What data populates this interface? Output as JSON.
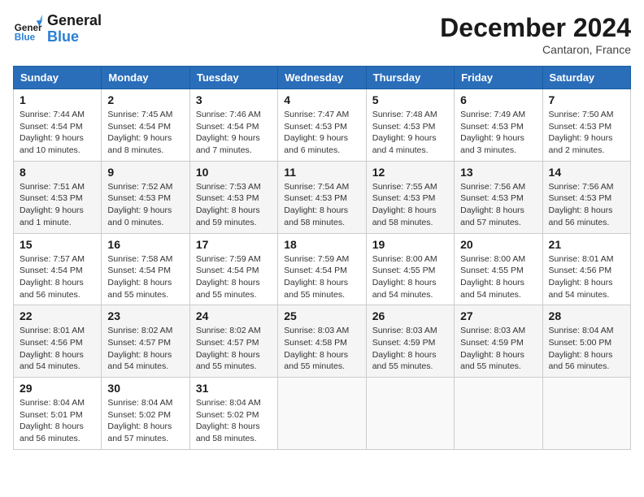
{
  "header": {
    "logo_line1": "General",
    "logo_line2": "Blue",
    "month": "December 2024",
    "location": "Cantaron, France"
  },
  "weekdays": [
    "Sunday",
    "Monday",
    "Tuesday",
    "Wednesday",
    "Thursday",
    "Friday",
    "Saturday"
  ],
  "weeks": [
    [
      {
        "day": "1",
        "info": "Sunrise: 7:44 AM\nSunset: 4:54 PM\nDaylight: 9 hours\nand 10 minutes."
      },
      {
        "day": "2",
        "info": "Sunrise: 7:45 AM\nSunset: 4:54 PM\nDaylight: 9 hours\nand 8 minutes."
      },
      {
        "day": "3",
        "info": "Sunrise: 7:46 AM\nSunset: 4:54 PM\nDaylight: 9 hours\nand 7 minutes."
      },
      {
        "day": "4",
        "info": "Sunrise: 7:47 AM\nSunset: 4:53 PM\nDaylight: 9 hours\nand 6 minutes."
      },
      {
        "day": "5",
        "info": "Sunrise: 7:48 AM\nSunset: 4:53 PM\nDaylight: 9 hours\nand 4 minutes."
      },
      {
        "day": "6",
        "info": "Sunrise: 7:49 AM\nSunset: 4:53 PM\nDaylight: 9 hours\nand 3 minutes."
      },
      {
        "day": "7",
        "info": "Sunrise: 7:50 AM\nSunset: 4:53 PM\nDaylight: 9 hours\nand 2 minutes."
      }
    ],
    [
      {
        "day": "8",
        "info": "Sunrise: 7:51 AM\nSunset: 4:53 PM\nDaylight: 9 hours\nand 1 minute."
      },
      {
        "day": "9",
        "info": "Sunrise: 7:52 AM\nSunset: 4:53 PM\nDaylight: 9 hours\nand 0 minutes."
      },
      {
        "day": "10",
        "info": "Sunrise: 7:53 AM\nSunset: 4:53 PM\nDaylight: 8 hours\nand 59 minutes."
      },
      {
        "day": "11",
        "info": "Sunrise: 7:54 AM\nSunset: 4:53 PM\nDaylight: 8 hours\nand 58 minutes."
      },
      {
        "day": "12",
        "info": "Sunrise: 7:55 AM\nSunset: 4:53 PM\nDaylight: 8 hours\nand 58 minutes."
      },
      {
        "day": "13",
        "info": "Sunrise: 7:56 AM\nSunset: 4:53 PM\nDaylight: 8 hours\nand 57 minutes."
      },
      {
        "day": "14",
        "info": "Sunrise: 7:56 AM\nSunset: 4:53 PM\nDaylight: 8 hours\nand 56 minutes."
      }
    ],
    [
      {
        "day": "15",
        "info": "Sunrise: 7:57 AM\nSunset: 4:54 PM\nDaylight: 8 hours\nand 56 minutes."
      },
      {
        "day": "16",
        "info": "Sunrise: 7:58 AM\nSunset: 4:54 PM\nDaylight: 8 hours\nand 55 minutes."
      },
      {
        "day": "17",
        "info": "Sunrise: 7:59 AM\nSunset: 4:54 PM\nDaylight: 8 hours\nand 55 minutes."
      },
      {
        "day": "18",
        "info": "Sunrise: 7:59 AM\nSunset: 4:54 PM\nDaylight: 8 hours\nand 55 minutes."
      },
      {
        "day": "19",
        "info": "Sunrise: 8:00 AM\nSunset: 4:55 PM\nDaylight: 8 hours\nand 54 minutes."
      },
      {
        "day": "20",
        "info": "Sunrise: 8:00 AM\nSunset: 4:55 PM\nDaylight: 8 hours\nand 54 minutes."
      },
      {
        "day": "21",
        "info": "Sunrise: 8:01 AM\nSunset: 4:56 PM\nDaylight: 8 hours\nand 54 minutes."
      }
    ],
    [
      {
        "day": "22",
        "info": "Sunrise: 8:01 AM\nSunset: 4:56 PM\nDaylight: 8 hours\nand 54 minutes."
      },
      {
        "day": "23",
        "info": "Sunrise: 8:02 AM\nSunset: 4:57 PM\nDaylight: 8 hours\nand 54 minutes."
      },
      {
        "day": "24",
        "info": "Sunrise: 8:02 AM\nSunset: 4:57 PM\nDaylight: 8 hours\nand 55 minutes."
      },
      {
        "day": "25",
        "info": "Sunrise: 8:03 AM\nSunset: 4:58 PM\nDaylight: 8 hours\nand 55 minutes."
      },
      {
        "day": "26",
        "info": "Sunrise: 8:03 AM\nSunset: 4:59 PM\nDaylight: 8 hours\nand 55 minutes."
      },
      {
        "day": "27",
        "info": "Sunrise: 8:03 AM\nSunset: 4:59 PM\nDaylight: 8 hours\nand 55 minutes."
      },
      {
        "day": "28",
        "info": "Sunrise: 8:04 AM\nSunset: 5:00 PM\nDaylight: 8 hours\nand 56 minutes."
      }
    ],
    [
      {
        "day": "29",
        "info": "Sunrise: 8:04 AM\nSunset: 5:01 PM\nDaylight: 8 hours\nand 56 minutes."
      },
      {
        "day": "30",
        "info": "Sunrise: 8:04 AM\nSunset: 5:02 PM\nDaylight: 8 hours\nand 57 minutes."
      },
      {
        "day": "31",
        "info": "Sunrise: 8:04 AM\nSunset: 5:02 PM\nDaylight: 8 hours\nand 58 minutes."
      },
      {
        "day": "",
        "info": ""
      },
      {
        "day": "",
        "info": ""
      },
      {
        "day": "",
        "info": ""
      },
      {
        "day": "",
        "info": ""
      }
    ]
  ]
}
